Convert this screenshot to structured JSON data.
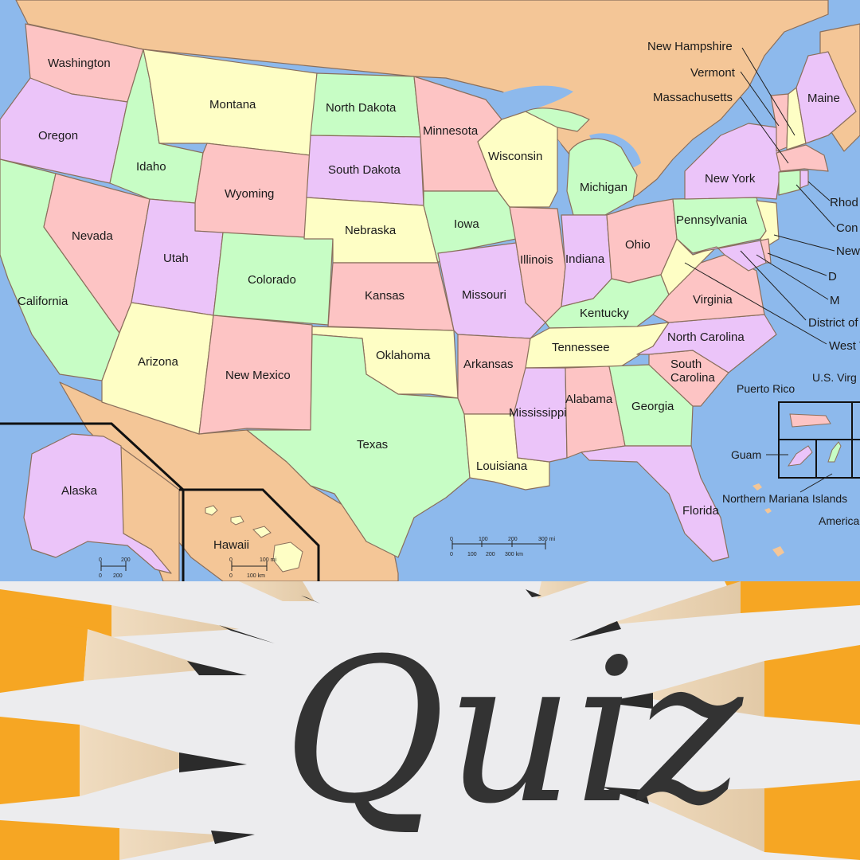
{
  "colors": {
    "water": "#8db9ec",
    "foreign_land": "#f4c697",
    "pink": "#fdc4c4",
    "purple": "#ebc4f9",
    "yellow": "#fefec5",
    "green": "#c7fdc5",
    "border": "#8a6f5c",
    "pencil_orange": "#f6a623",
    "quiz_text": "#333333",
    "quiz_bg": "#ececee"
  },
  "states": {
    "washington": "Washington",
    "oregon": "Oregon",
    "california": "California",
    "nevada": "Nevada",
    "idaho": "Idaho",
    "montana": "Montana",
    "wyoming": "Wyoming",
    "utah": "Utah",
    "arizona": "Arizona",
    "colorado": "Colorado",
    "new_mexico": "New Mexico",
    "north_dakota": "North Dakota",
    "south_dakota": "South Dakota",
    "nebraska": "Nebraska",
    "kansas": "Kansas",
    "oklahoma": "Oklahoma",
    "texas": "Texas",
    "minnesota": "Minnesota",
    "iowa": "Iowa",
    "missouri": "Missouri",
    "arkansas": "Arkansas",
    "louisiana": "Louisiana",
    "wisconsin": "Wisconsin",
    "illinois": "Illinois",
    "michigan": "Michigan",
    "indiana": "Indiana",
    "ohio": "Ohio",
    "kentucky": "Kentucky",
    "tennessee": "Tennessee",
    "mississippi": "Mississippi",
    "alabama": "Alabama",
    "georgia": "Georgia",
    "florida": "Florida",
    "south_carolina_1": "South",
    "south_carolina_2": "Carolina",
    "north_carolina": "North Carolina",
    "virginia": "Virginia",
    "west_virginia": "West V",
    "pennsylvania": "Pennsylvania",
    "new_york": "New York",
    "maine": "Maine",
    "new_hampshire": "New Hampshire",
    "vermont": "Vermont",
    "massachusetts": "Massachusetts",
    "rhode_island": "Rhod",
    "connecticut": "Con",
    "new_jersey": "New",
    "delaware": "D",
    "maryland": "M",
    "district_of_columbia": "District of",
    "alaska": "Alaska",
    "hawaii": "Hawaii"
  },
  "territories": {
    "us_virgin_islands": "U.S. Virg",
    "puerto_rico": "Puerto Rico",
    "guam": "Guam",
    "northern_mariana_islands": "Northern Mariana Islands",
    "american_samoa": "America"
  },
  "scale_bars": {
    "main_mi": [
      "0",
      "100",
      "200",
      "300 mi"
    ],
    "main_km": [
      "0",
      "100",
      "200",
      "300 km"
    ],
    "alaska_mi": [
      "0",
      "200"
    ],
    "alaska_km": [
      "0",
      "200"
    ],
    "hawaii_mi": [
      "0",
      "100 mi"
    ],
    "hawaii_km": [
      "0",
      "100 km"
    ]
  },
  "banner": {
    "word": "Quiz"
  }
}
